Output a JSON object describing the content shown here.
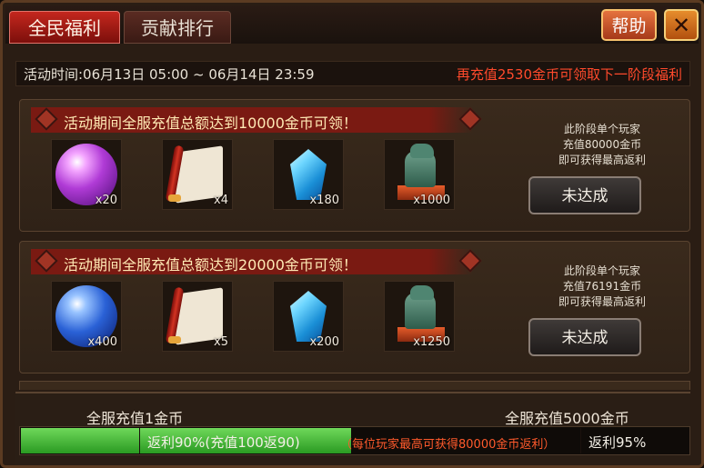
{
  "tabs": [
    "全民福利",
    "贡献排行"
  ],
  "buttons": {
    "help": "帮助",
    "close": "✕"
  },
  "info": {
    "time": "活动时间:06月13日 05:00 ~ 06月14日 23:59",
    "next_stage": "再充值2530金币可领取下一阶段福利"
  },
  "tiers": [
    {
      "title": "活动期间全服充值总额达到10000金币可领！",
      "items": [
        {
          "icon": "purple-orb",
          "qty": "x20"
        },
        {
          "icon": "scroll",
          "qty": "x4"
        },
        {
          "icon": "blue-gem",
          "qty": "x180"
        },
        {
          "icon": "dragon-statue",
          "qty": "x1000"
        }
      ],
      "note": [
        "此阶段单个玩家",
        "充值80000金币",
        "即可获得最高返利"
      ],
      "button": "未达成"
    },
    {
      "title": "活动期间全服充值总额达到20000金币可领！",
      "items": [
        {
          "icon": "blue-orb",
          "qty": "x400"
        },
        {
          "icon": "scroll",
          "qty": "x5"
        },
        {
          "icon": "blue-gem",
          "qty": "x200"
        },
        {
          "icon": "dragon-statue",
          "qty": "x1250"
        }
      ],
      "note": [
        "此阶段单个玩家",
        "充值76191金币",
        "即可获得最高返利"
      ],
      "button": "未达成"
    }
  ],
  "progress": {
    "label_left": "全服充值1金币",
    "label_right": "全服充值5000金币",
    "fill_fraction": 0.495,
    "segment1_text": "返利90%(充值100返90)",
    "note": "（每位玩家最高可获得80000金币返利）",
    "segment3_text": "返利95%"
  }
}
